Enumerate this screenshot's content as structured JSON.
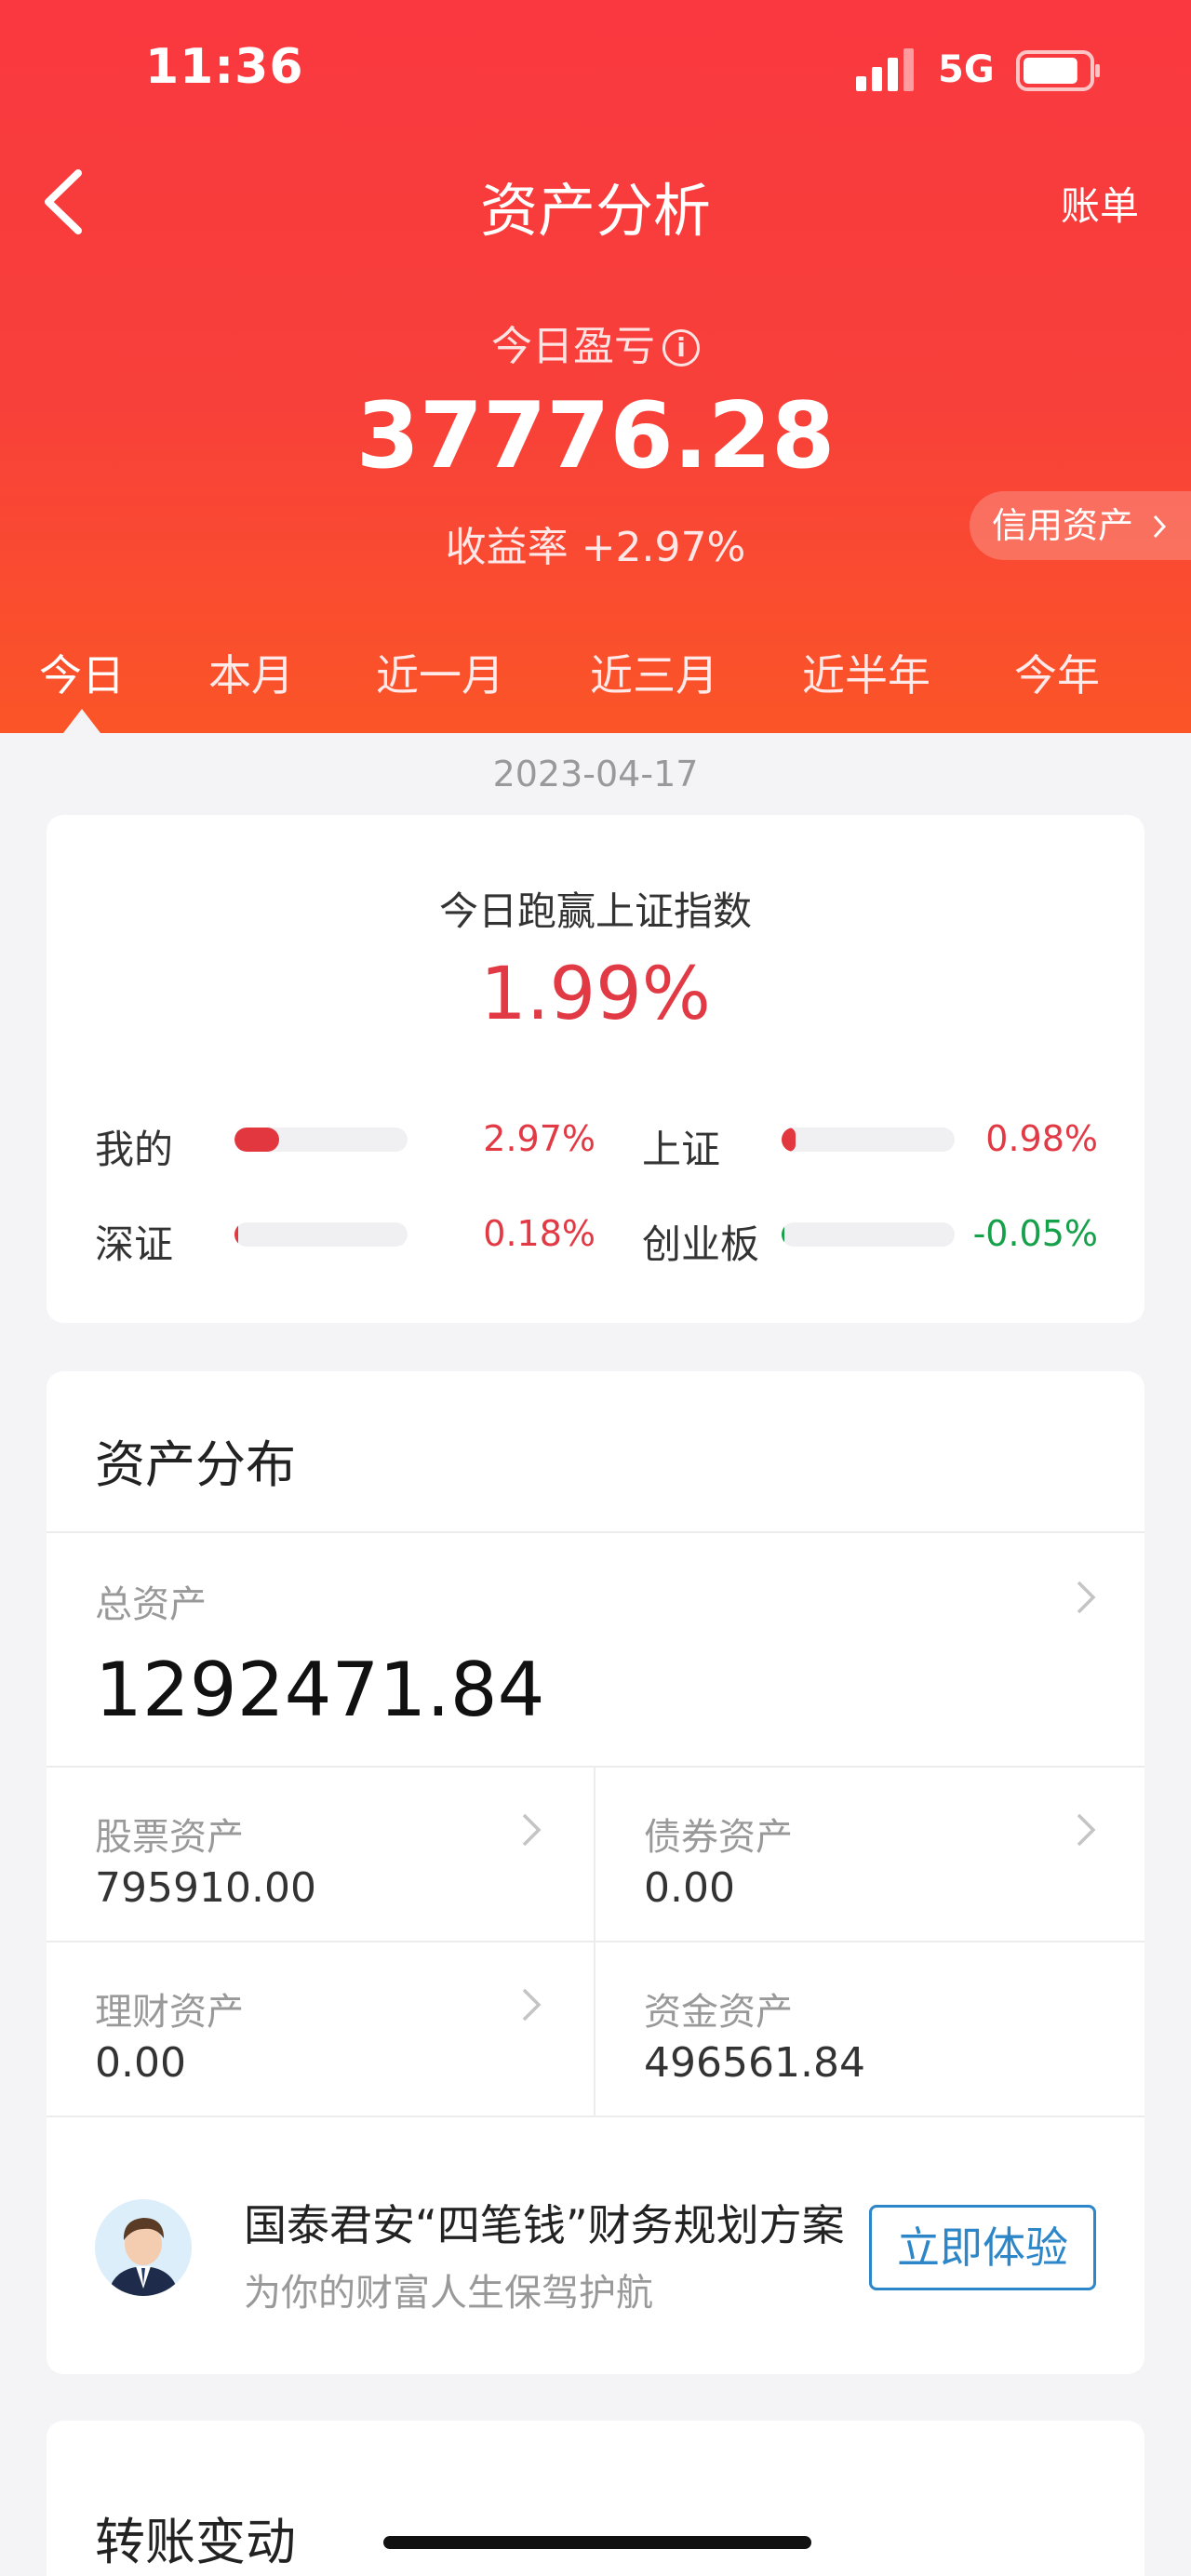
{
  "status_bar": {
    "time": "11:36",
    "network": "5G",
    "battery_level": 0.85
  },
  "nav": {
    "back_icon": "chevron-left-icon",
    "title": "资产分析",
    "right_action": "账单"
  },
  "summary": {
    "pnl_label": "今日盈亏",
    "info_icon": "i",
    "pnl_value": "37776.28",
    "rate_text": "收益率 +2.97%",
    "credit_label": "信用资产"
  },
  "tabs": [
    {
      "label": "今日",
      "active": true
    },
    {
      "label": "本月"
    },
    {
      "label": "近一月"
    },
    {
      "label": "近三月"
    },
    {
      "label": "近半年"
    },
    {
      "label": "今年"
    }
  ],
  "date": "2023-04-17",
  "comparison": {
    "title": "今日跑赢上证指数",
    "value": "1.99%",
    "items": [
      {
        "label": "我的",
        "value": "2.97%",
        "bar": 0.26,
        "color": "red"
      },
      {
        "label": "上证",
        "value": "0.98%",
        "bar": 0.08,
        "color": "red"
      },
      {
        "label": "深证",
        "value": "0.18%",
        "bar": 0.02,
        "color": "red"
      },
      {
        "label": "创业板",
        "value": "-0.05%",
        "bar": 0.0,
        "color": "green"
      }
    ]
  },
  "assets": {
    "title": "资产分布",
    "total_label": "总资产",
    "total_value": "1292471.84",
    "items": [
      {
        "label": "股票资产",
        "value": "795910.00",
        "has_arrow": true
      },
      {
        "label": "债券资产",
        "value": "0.00",
        "has_arrow": true
      },
      {
        "label": "理财资产",
        "value": "0.00",
        "has_arrow": true
      },
      {
        "label": "资金资产",
        "value": "496561.84",
        "has_arrow": false
      }
    ],
    "promo": {
      "title": "国泰君安“四笔钱”财务规划方案",
      "subtitle": "为你的财富人生保驾护航",
      "button": "立即体验"
    }
  },
  "transfer": {
    "title": "转账变动"
  },
  "colors": {
    "header_red": "#f9383f",
    "gain_red": "#e23a45",
    "loss_green": "#15a04a",
    "link_blue": "#2c86c8"
  }
}
